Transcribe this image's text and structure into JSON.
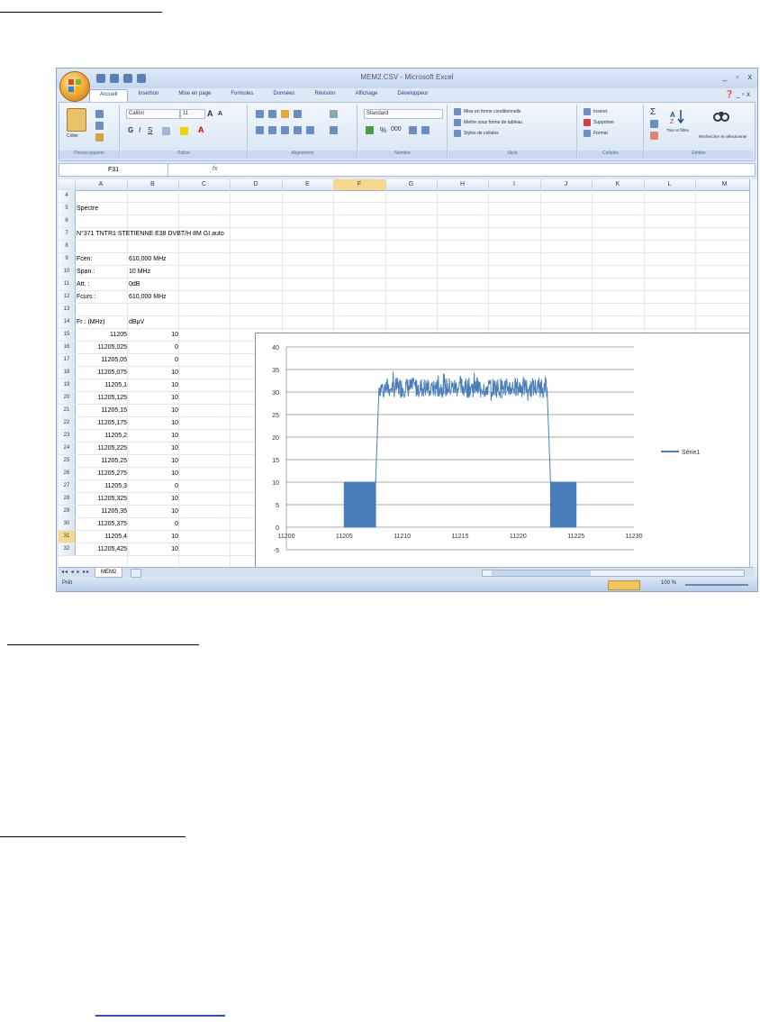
{
  "window": {
    "title": "MEM2.CSV - Microsoft Excel",
    "controls": [
      "_",
      "▫",
      "x"
    ]
  },
  "ribbon_tabs": [
    "Accueil",
    "Insertion",
    "Mise en page",
    "Formules",
    "Données",
    "Révision",
    "Affichage",
    "Développeur"
  ],
  "ribbon": {
    "clipboard": {
      "paste_label": "Coller",
      "group_label": "Presse-papiers"
    },
    "font": {
      "name": "Calibri",
      "size": "11",
      "group_label": "Police"
    },
    "alignment": {
      "group_label": "Alignement"
    },
    "number": {
      "format": "Standard",
      "group_label": "Nombre"
    },
    "style": {
      "conditional": "Mise en forme conditionnelle",
      "table": "Mettre sous forme de tableau",
      "cell_styles": "Styles de cellules",
      "group_label": "Style"
    },
    "cells": {
      "insert": "Insérer",
      "delete": "Supprimer",
      "format": "Format",
      "group_label": "Cellules"
    },
    "editing": {
      "sort": "Trier et filtrer",
      "find": "Rechercher et sélectionner",
      "group_label": "Édition"
    }
  },
  "formula_bar": {
    "name_box": "F31",
    "fx": "fx"
  },
  "columns": [
    "A",
    "B",
    "C",
    "D",
    "E",
    "F",
    "G",
    "H",
    "I",
    "J",
    "K",
    "L",
    "M"
  ],
  "selected_column": "F",
  "rows": [
    {
      "n": "4",
      "a": "",
      "b": ""
    },
    {
      "n": "5",
      "a": "Spectre",
      "b": ""
    },
    {
      "n": "6",
      "a": "",
      "b": ""
    },
    {
      "n": "7",
      "a": "N°371 TNTR1 STETIENNE E38 DVBT/H 8M GI auto",
      "b": ""
    },
    {
      "n": "8",
      "a": "",
      "b": ""
    },
    {
      "n": "9",
      "a": "Fcen:",
      "b": "610,000 MHz"
    },
    {
      "n": "10",
      "a": "Span :",
      "b": "10 MHz"
    },
    {
      "n": "11",
      "a": "Att. :",
      "b": "0dB"
    },
    {
      "n": "12",
      "a": "Fcurs :",
      "b": "610,000 MHz"
    },
    {
      "n": "13",
      "a": "",
      "b": ""
    },
    {
      "n": "14",
      "a": "Fr : (MHz)",
      "b": "dBµV"
    },
    {
      "n": "15",
      "a": "11205",
      "b": "10",
      "num": true
    },
    {
      "n": "16",
      "a": "11205,025",
      "b": "0",
      "num": true
    },
    {
      "n": "17",
      "a": "11205,05",
      "b": "0",
      "num": true
    },
    {
      "n": "18",
      "a": "11205,075",
      "b": "10",
      "num": true
    },
    {
      "n": "19",
      "a": "11205,1",
      "b": "10",
      "num": true
    },
    {
      "n": "20",
      "a": "11205,125",
      "b": "10",
      "num": true
    },
    {
      "n": "21",
      "a": "11205,15",
      "b": "10",
      "num": true
    },
    {
      "n": "22",
      "a": "11205,175",
      "b": "10",
      "num": true
    },
    {
      "n": "23",
      "a": "11205,2",
      "b": "10",
      "num": true
    },
    {
      "n": "24",
      "a": "11205,225",
      "b": "10",
      "num": true
    },
    {
      "n": "25",
      "a": "11205,25",
      "b": "10",
      "num": true
    },
    {
      "n": "26",
      "a": "11205,275",
      "b": "10",
      "num": true
    },
    {
      "n": "27",
      "a": "11205,3",
      "b": "0",
      "num": true
    },
    {
      "n": "28",
      "a": "11205,325",
      "b": "10",
      "num": true
    },
    {
      "n": "29",
      "a": "11205,35",
      "b": "10",
      "num": true
    },
    {
      "n": "30",
      "a": "11205,375",
      "b": "0",
      "num": true
    },
    {
      "n": "31",
      "a": "11205,4",
      "b": "10",
      "num": true,
      "selected": true
    },
    {
      "n": "32",
      "a": "11205,425",
      "b": "10",
      "num": true
    }
  ],
  "sheet_tab": "MEM2",
  "status": {
    "text": "Prêt",
    "zoom": "100 %"
  },
  "chart_data": {
    "type": "line",
    "title": "",
    "xlabel": "",
    "ylabel": "",
    "xlim": [
      11200,
      11230
    ],
    "ylim": [
      -5,
      40
    ],
    "xticks": [
      11200,
      11205,
      11210,
      11215,
      11220,
      11225,
      11230
    ],
    "yticks": [
      -5,
      0,
      5,
      10,
      15,
      20,
      25,
      30,
      35,
      40
    ],
    "grid": true,
    "legend": "right",
    "series": [
      {
        "name": "Série1",
        "color": "#4a7ebb",
        "segments": [
          {
            "x_from": 11205,
            "x_to": 11207.7,
            "low": 0,
            "high": 10,
            "type": "toggle"
          },
          {
            "x_from": 11207.7,
            "x_to": 11208.0,
            "y_from": 10,
            "y_to": 31,
            "type": "ramp"
          },
          {
            "x_from": 11208.0,
            "x_to": 11222.5,
            "mean": 31,
            "min": 28,
            "max": 35,
            "type": "noise"
          },
          {
            "x_from": 11222.5,
            "x_to": 11222.8,
            "y_from": 31,
            "y_to": 10,
            "type": "ramp"
          },
          {
            "x_from": 11222.8,
            "x_to": 11225,
            "low": 0,
            "high": 10,
            "type": "toggle"
          }
        ]
      }
    ]
  }
}
